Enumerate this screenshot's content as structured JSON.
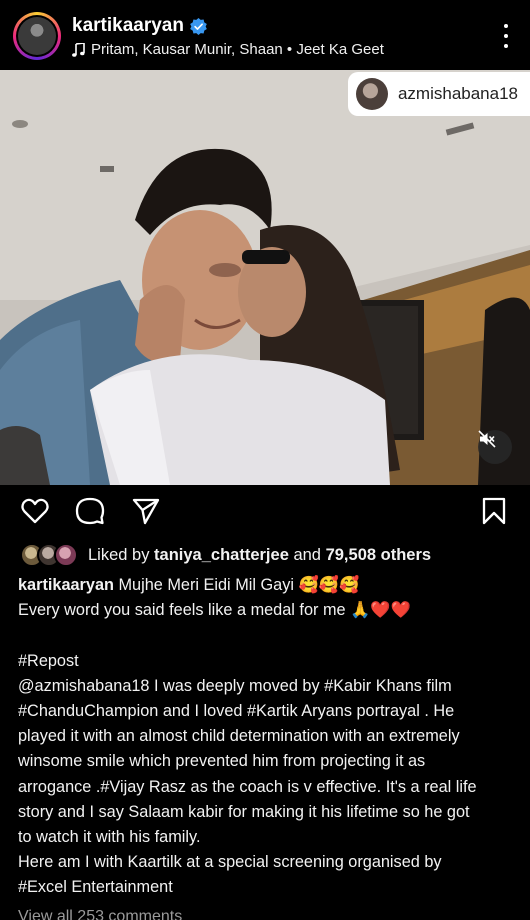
{
  "header": {
    "username": "kartikaaryan",
    "music": "Pritam, Kausar Munir, Shaan • Jeet Ka Geet"
  },
  "photo": {
    "tagged_user": "azmishabana18"
  },
  "actions": {
    "like_icon": "heart-icon",
    "comment_icon": "comment-icon",
    "share_icon": "send-icon",
    "save_icon": "bookmark-icon"
  },
  "likes": {
    "prefix": "Liked by ",
    "user": "taniya_chatterjee",
    "middle": " and ",
    "count": "79,508 others"
  },
  "caption": {
    "author": "kartikaaryan",
    "line1": " Mujhe Meri Eidi Mil Gayi 🥰🥰🥰",
    "line2": "Every word you said feels like a medal for me 🙏❤️❤️",
    "line3": "#Repost",
    "line4": "@azmishabana18 I was deeply moved by #Kabir Khans film",
    "line5": "#ChanduChampion and I loved #Kartik Aryans portrayal . He",
    "line6": "played it with an almost child determination  with an extremely",
    "line7": "winsome smile which prevented him from projecting it as",
    "line8": "arrogance .#Vijay Rasz as the coach is v effective. It's a real life",
    "line9": "story and I say Salaam kabir for making it his lifetime so he got",
    "line10": "to watch it with his family.",
    "line11": "Here am I with Kaartilk at a special screening organised by",
    "line12": "#Excel Entertainment"
  },
  "view_comments": "View all 253 comments",
  "colors": {
    "background": "#000000",
    "text": "#f2f2f2",
    "verified": "#3897f0",
    "muted": "#9a9a9a"
  }
}
